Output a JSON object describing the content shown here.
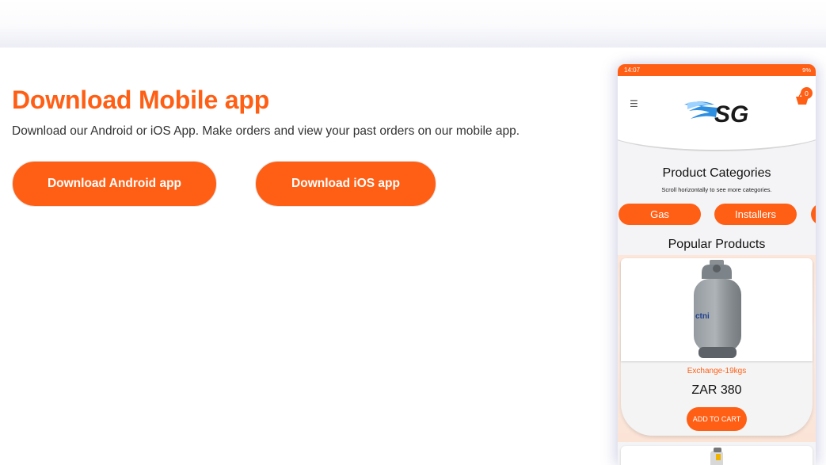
{
  "section": {
    "title": "Download Mobile app",
    "subtitle": "Download our Android or iOS App. Make orders and view your past orders on our mobile app.",
    "buttons": {
      "android": "Download Android app",
      "ios": "Download iOS app"
    }
  },
  "phone": {
    "status": {
      "time": "14:07",
      "right": "9%"
    },
    "header": {
      "logo_text": "SG",
      "cart_count": "0"
    },
    "categories": {
      "title": "Product Categories",
      "hint": "Scroll horizontally to see more categories.",
      "items": [
        "Gas",
        "Installers"
      ]
    },
    "popular": {
      "title": "Popular Products",
      "product": {
        "name": "Exchange-19kgs",
        "price": "ZAR 380",
        "button": "ADD TO CART",
        "brand_text": "ctni"
      }
    }
  },
  "colors": {
    "accent": "#ff5f15",
    "bg": "#ffffff"
  },
  "icons": [
    "menu-icon",
    "cart-icon",
    "gas-cylinder-image"
  ]
}
